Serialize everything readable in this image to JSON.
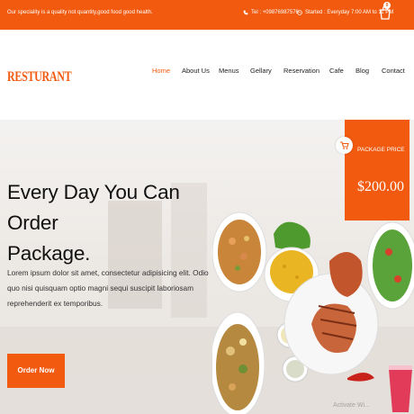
{
  "topbar": {
    "tagline": "Our speciality is a quality not quantity,good food good health.",
    "phone": "Tel : +09876987576",
    "hours": "Started : Everyday 7:00 AM to 11 PM",
    "cart_count": "0"
  },
  "brand": {
    "logo": "RESTURANT"
  },
  "nav": {
    "items": [
      "Home",
      "About Us",
      "Menus",
      "Gellary",
      "Reservation",
      "Cafe",
      "Blog",
      "Contact"
    ],
    "active": "Home"
  },
  "hero": {
    "headline_line1": "Every Day You Can Order",
    "headline_line2": "Package.",
    "paragraph": "Lorem ipsum dolor sit amet, consectetur adipisicing elit. Odio quo nisi quisquam optio magni sequi suscipit laboriosam reprehenderit ex temporibus.",
    "cta": "Order Now"
  },
  "package": {
    "label": "PACKAGE PRICE",
    "price": "$200.00"
  },
  "watermark": "Activate Wi...",
  "colors": {
    "accent": "#f15a0f",
    "text": "#111111"
  }
}
